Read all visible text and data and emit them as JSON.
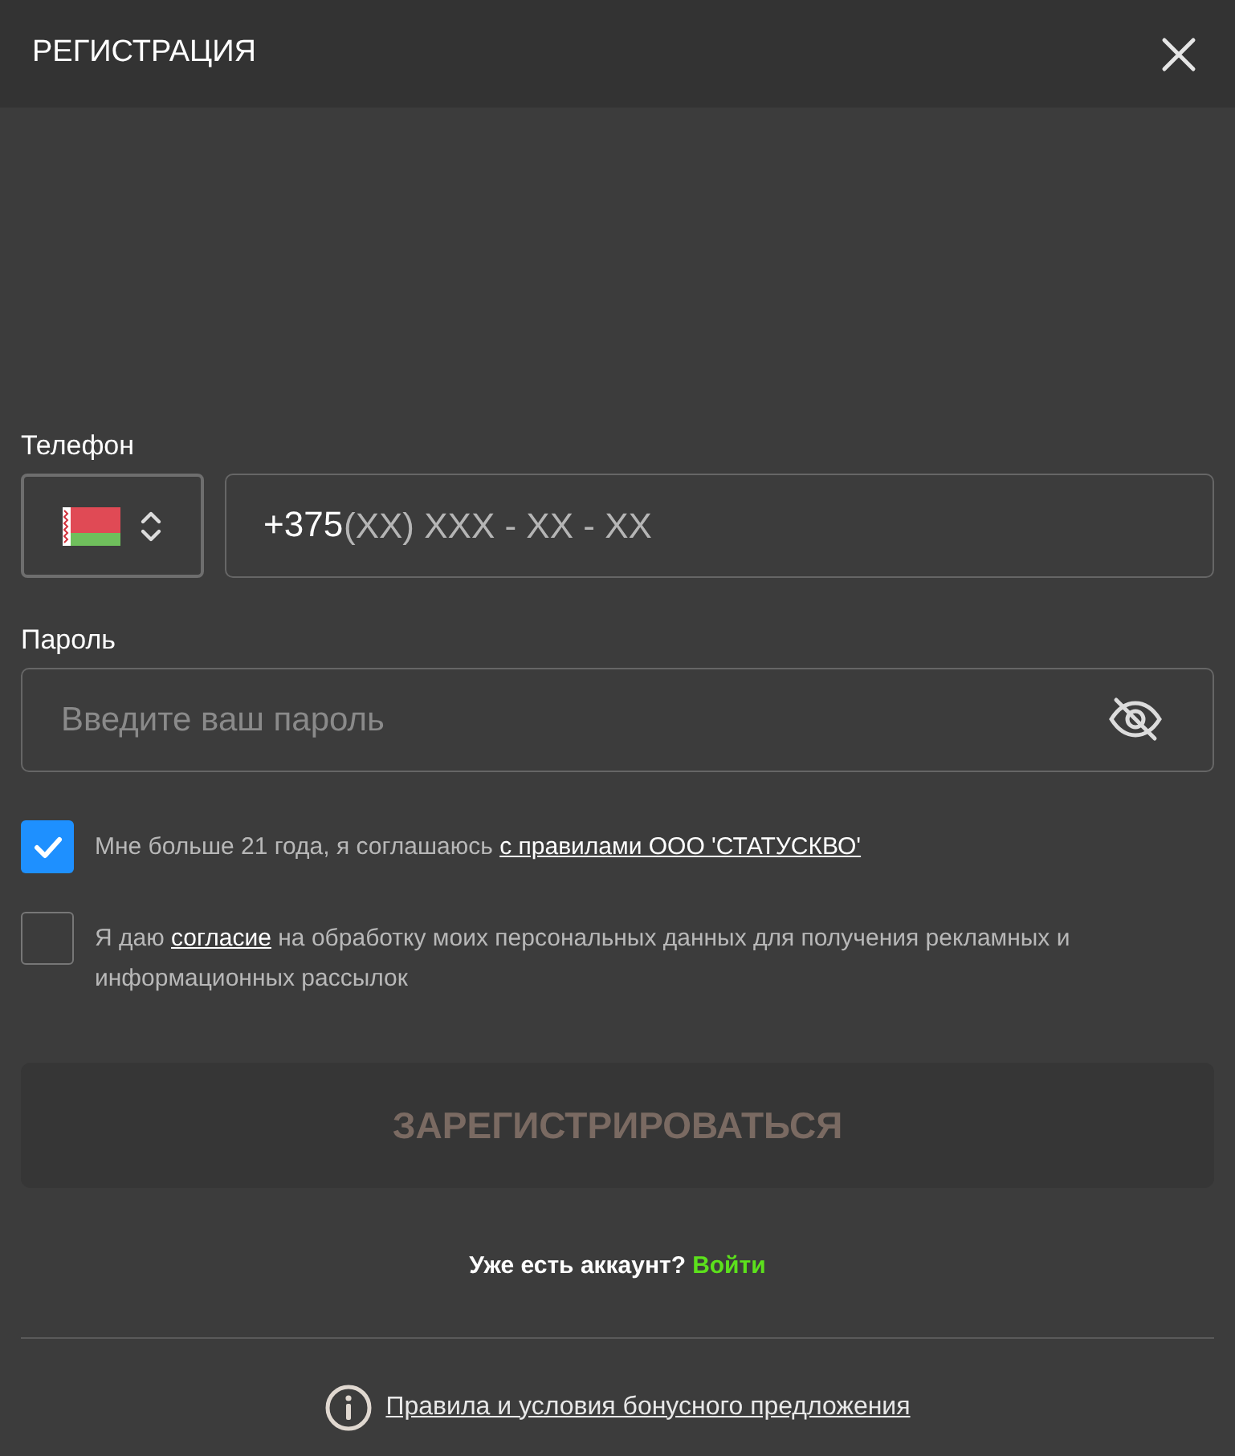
{
  "window": {
    "title": "РЕГИСТРАЦИЯ"
  },
  "phone": {
    "label": "Телефон",
    "prefix": "+375",
    "placeholder": "(XX) XXX - XX - XX"
  },
  "password": {
    "label": "Пароль",
    "placeholder": "Введите ваш пароль"
  },
  "agreements": [
    {
      "checked": true,
      "before": "Мне больше 21 года, я соглашаюсь ",
      "link": "с правилами ООО 'СТАТУСКВО'"
    },
    {
      "checked": false,
      "before": "Я даю ",
      "link": "согласие",
      "after": " на обработку моих персональных данных для получения рекламных и информационных рассылок"
    }
  ],
  "register_button": {
    "label": "ЗАРЕГИСТРИРОВАТЬСЯ",
    "disabled": true
  },
  "login_prompt": {
    "text": "Уже есть аккаунт?",
    "link": "Войти"
  },
  "footer_link": "Правила и условия бонусного предложения"
}
